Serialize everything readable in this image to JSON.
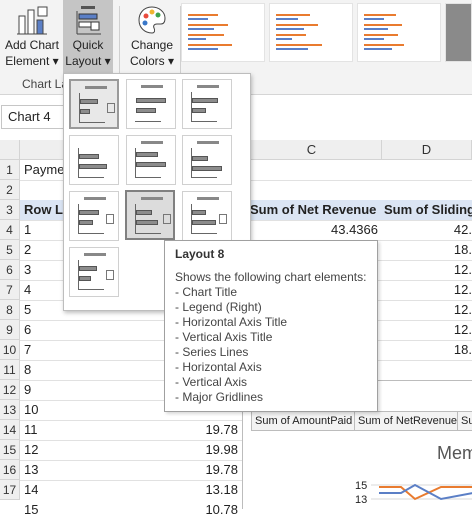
{
  "ribbon": {
    "add_chart_line1": "Add Chart",
    "add_chart_line2": "Element",
    "quick_layout_line1": "Quick",
    "quick_layout_line2": "Layout",
    "change_colors_line1": "Change",
    "change_colors_line2": "Colors",
    "group_label": "Chart La",
    "dropdown_arrow": "▾"
  },
  "namebox": {
    "value": "Chart 4"
  },
  "sheet": {
    "columns": [
      "C",
      "D"
    ],
    "rows": [
      "1",
      "2",
      "3",
      "4",
      "5",
      "6",
      "7",
      "8",
      "9",
      "10",
      "11",
      "12",
      "13",
      "14",
      "15",
      "16",
      "17"
    ],
    "a1": "Payme",
    "a3": "Row La",
    "c3": "Sum of Net Revenue",
    "d3": "Sum of Sliding",
    "row_labels": [
      "1",
      "2",
      "3",
      "4",
      "5",
      "6",
      "7",
      "8",
      "9",
      "10",
      "11",
      "12",
      "13",
      "14",
      "15"
    ],
    "c4": "43.4366",
    "d_values": [
      "42.",
      "18.",
      "12.",
      "12.",
      "12.",
      "12.",
      "18."
    ],
    "b_values": [
      "19.78",
      "19.98",
      "19.78",
      "13.18",
      "10.78"
    ]
  },
  "chart": {
    "tabs": [
      "Sum of AmountPaid",
      "Sum of NetRevenue",
      "Su"
    ],
    "title": "Mem",
    "y_ticks": [
      "15",
      "13"
    ]
  },
  "tooltip": {
    "title": "Layout 8",
    "description": "Shows the following chart elements:",
    "items": [
      "- Chart Title",
      "- Legend (Right)",
      "- Horizontal Axis Title",
      "- Vertical Axis Title",
      "- Series Lines",
      "- Horizontal Axis",
      "- Vertical Axis",
      "- Major Gridlines"
    ]
  },
  "colors": {
    "accent_orange": "#e97b2f",
    "accent_blue": "#5b7fc6",
    "grid": "#e1e1e1",
    "header_bg": "#efefef",
    "row_label_band": "#dbe5f4"
  }
}
